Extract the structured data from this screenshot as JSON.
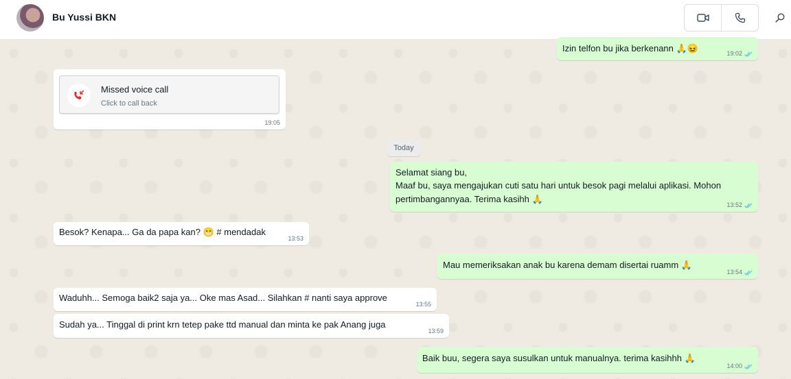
{
  "header": {
    "contact_name": "Bu Yussi BKN"
  },
  "date_separator": "Today",
  "messages": [
    {
      "text": "Izin telfon bu jika berkenann 🙏😖",
      "time": "19:02"
    },
    {
      "missed_title": "Missed voice call",
      "missed_sub": "Click to call back",
      "time": "19:05"
    },
    {
      "line1": "Selamat siang bu,",
      "line2": "Maaf bu, saya mengajukan cuti satu hari untuk besok pagi melalui aplikasi. Mohon",
      "line3": "pertimbangannyaa. Terima kasihh 🙏",
      "time": "13:52"
    },
    {
      "text": "Besok? Kenapa... Ga da papa kan? 😁 # mendadak",
      "time": "13:53"
    },
    {
      "text": "Mau memeriksakan anak bu karena demam disertai ruamm 🙏",
      "time": "13:54"
    },
    {
      "text": "Waduhh... Semoga baik2 saja ya... Oke mas Asad... Silahkan # nanti saya approve",
      "time": "13:55"
    },
    {
      "text": "Sudah ya... Tinggal di print krn tetep pake ttd manual dan minta ke pak Anang juga",
      "time": "13:59"
    },
    {
      "text": "Baik buu, segera saya susulkan untuk manualnya. terima kasihhh 🙏",
      "time": "14:00"
    }
  ],
  "icons": {
    "video": "video-camera-icon",
    "call": "phone-icon",
    "search": "search-icon",
    "missed": "missed-call-icon",
    "read": "double-check-icon"
  },
  "colors": {
    "incoming_bubble": "#ffffff",
    "outgoing_bubble": "#d9fdd3",
    "read_ticks": "#53bdeb",
    "missed_call_red": "#e02a2a",
    "chat_background": "#efeae2"
  }
}
